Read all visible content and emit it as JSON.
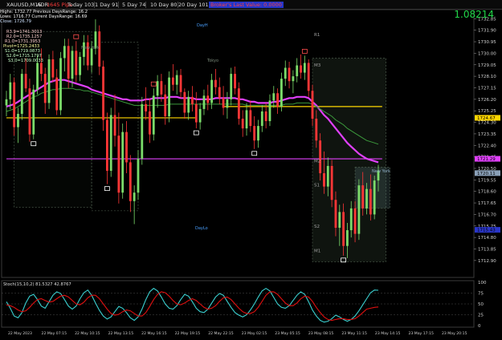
{
  "toolbar": {
    "symbol": "XAUUSD,M15",
    "adr_label": "ADR:",
    "adr_value": "1645 Pips",
    "stats": [
      {
        "label": "Today",
        "value": "103"
      },
      {
        "label": "1 Day",
        "value": "91"
      },
      {
        "label": "5 Day",
        "value": "74"
      },
      {
        "label": "10 Day",
        "value": "80"
      },
      {
        "label": "20 Day",
        "value": "101"
      }
    ],
    "spread_text": "Broker's Last Value: 0.0000"
  },
  "big_price": "1.08214",
  "info_panel": {
    "line1": "Highs: 1732.77 Previous DaysRange: 16.2",
    "line2": "Lows: 1716.77 Current DaysRange: 16.69",
    "line3": "Close: 1726.79",
    "pivots": [
      "R3.9=1741.3013",
      "R2.0=1735.1257",
      "R1.0=1731.3953",
      "Pivot=1725.2433",
      "S1.0=1719.0873",
      "S2.0=1715.1797",
      "S3.0=1709.0033"
    ]
  },
  "chart_data": {
    "type": "candlestick",
    "symbol": "XAUUSD",
    "timeframe": "M15",
    "price_axis": {
      "ylim": [
        1711.5,
        1733.6
      ],
      "ticks": [
        1732.85,
        1731.9,
        1730.95,
        1730.0,
        1729.05,
        1728.1,
        1727.15,
        1726.2,
        1725.25,
        1724.3,
        1723.35,
        1722.4,
        1721.45,
        1720.5,
        1719.55,
        1718.6,
        1717.65,
        1716.7,
        1715.75,
        1714.8,
        1713.85,
        1712.9
      ],
      "markers": [
        {
          "value": 1724.67,
          "color": "#ffd700"
        },
        {
          "value": 1721.29,
          "color": "#e040fb"
        },
        {
          "value": 1720.11,
          "color": "#8aa0b8"
        },
        {
          "value": 1715.43,
          "color": "#2a36c8"
        }
      ]
    },
    "time_axis": [
      "22 May 2023",
      "22 May 07:15",
      "22 May 10:15",
      "22 May 13:15",
      "22 May 16:15",
      "22 May 19:15",
      "22 May 22:15",
      "23 May 02:15",
      "23 May 05:15",
      "23 May 08:15",
      "23 May 11:15",
      "23 May 14:15",
      "23 May 17:15",
      "23 May 20:15"
    ],
    "candles": [
      [
        1725.7,
        1726.9,
        1724.8,
        1726.2
      ],
      [
        1726.2,
        1728.3,
        1725.4,
        1727.6
      ],
      [
        1727.6,
        1728.0,
        1723.2,
        1723.9
      ],
      [
        1723.9,
        1725.5,
        1722.6,
        1725.0
      ],
      [
        1725.0,
        1728.7,
        1724.5,
        1728.3
      ],
      [
        1728.3,
        1729.6,
        1726.8,
        1727.1
      ],
      [
        1727.1,
        1727.9,
        1722.7,
        1723.3
      ],
      [
        1723.3,
        1727.4,
        1722.9,
        1727.0
      ],
      [
        1727.0,
        1729.8,
        1726.6,
        1729.2
      ],
      [
        1729.2,
        1730.4,
        1727.7,
        1728.3
      ],
      [
        1728.3,
        1728.8,
        1725.0,
        1725.9
      ],
      [
        1725.9,
        1729.9,
        1725.4,
        1729.5
      ],
      [
        1729.5,
        1730.2,
        1727.6,
        1728.0
      ],
      [
        1728.0,
        1728.7,
        1724.9,
        1725.3
      ],
      [
        1725.3,
        1730.1,
        1724.9,
        1729.6
      ],
      [
        1729.6,
        1731.2,
        1728.5,
        1730.6
      ],
      [
        1730.6,
        1731.2,
        1727.1,
        1727.9
      ],
      [
        1727.9,
        1730.6,
        1727.2,
        1730.2
      ],
      [
        1730.2,
        1731.0,
        1727.6,
        1728.2
      ],
      [
        1728.2,
        1730.1,
        1727.7,
        1729.7
      ],
      [
        1729.7,
        1731.5,
        1729.0,
        1730.9
      ],
      [
        1730.9,
        1731.5,
        1728.6,
        1729.0
      ],
      [
        1729.0,
        1731.0,
        1728.4,
        1730.4
      ],
      [
        1730.4,
        1732.8,
        1729.9,
        1731.8
      ],
      [
        1731.8,
        1732.3,
        1728.2,
        1728.9
      ],
      [
        1728.9,
        1729.4,
        1723.6,
        1724.5
      ],
      [
        1724.5,
        1725.1,
        1719.2,
        1720.3
      ],
      [
        1720.3,
        1725.5,
        1719.8,
        1724.9
      ],
      [
        1724.9,
        1726.6,
        1722.3,
        1723.2
      ],
      [
        1723.2,
        1725.1,
        1717.6,
        1718.5
      ],
      [
        1718.5,
        1724.2,
        1718.0,
        1723.5
      ],
      [
        1723.5,
        1724.4,
        1720.1,
        1721.0
      ],
      [
        1721.0,
        1721.6,
        1716.9,
        1717.8
      ],
      [
        1717.8,
        1719.1,
        1715.9,
        1718.5
      ],
      [
        1718.5,
        1722.0,
        1717.9,
        1721.3
      ],
      [
        1721.3,
        1726.4,
        1720.8,
        1725.8
      ],
      [
        1725.8,
        1727.2,
        1724.5,
        1725.2
      ],
      [
        1725.2,
        1726.3,
        1722.6,
        1723.3
      ],
      [
        1723.3,
        1727.1,
        1722.8,
        1726.5
      ],
      [
        1726.5,
        1728.2,
        1725.5,
        1727.7
      ],
      [
        1727.7,
        1728.3,
        1726.0,
        1726.6
      ],
      [
        1726.6,
        1727.4,
        1724.1,
        1724.8
      ],
      [
        1724.8,
        1728.5,
        1724.3,
        1728.0
      ],
      [
        1728.0,
        1729.1,
        1726.9,
        1727.4
      ],
      [
        1727.4,
        1728.6,
        1726.6,
        1728.2
      ],
      [
        1728.2,
        1728.7,
        1726.3,
        1726.8
      ],
      [
        1726.8,
        1727.1,
        1724.6,
        1725.1
      ],
      [
        1725.1,
        1726.9,
        1724.5,
        1726.4
      ],
      [
        1726.4,
        1727.3,
        1725.2,
        1725.8
      ],
      [
        1725.8,
        1726.8,
        1723.8,
        1724.3
      ],
      [
        1724.3,
        1725.9,
        1723.7,
        1725.4
      ],
      [
        1725.4,
        1727.0,
        1724.9,
        1726.5
      ],
      [
        1726.5,
        1727.4,
        1725.3,
        1725.9
      ],
      [
        1725.9,
        1728.3,
        1725.4,
        1727.8
      ],
      [
        1727.8,
        1728.7,
        1726.6,
        1727.2
      ],
      [
        1727.2,
        1728.0,
        1725.8,
        1726.3
      ],
      [
        1726.3,
        1727.3,
        1724.9,
        1725.5
      ],
      [
        1725.5,
        1726.8,
        1724.6,
        1726.2
      ],
      [
        1726.2,
        1728.8,
        1725.7,
        1728.3
      ],
      [
        1728.3,
        1728.9,
        1726.6,
        1727.1
      ],
      [
        1727.1,
        1727.6,
        1724.1,
        1724.6
      ],
      [
        1724.6,
        1725.3,
        1723.1,
        1723.8
      ],
      [
        1723.8,
        1725.9,
        1723.2,
        1725.3
      ],
      [
        1725.3,
        1726.1,
        1723.5,
        1724.0
      ],
      [
        1724.0,
        1724.8,
        1722.1,
        1722.8
      ],
      [
        1722.8,
        1724.5,
        1722.2,
        1724.0
      ],
      [
        1724.0,
        1725.7,
        1723.5,
        1725.2
      ],
      [
        1725.2,
        1725.9,
        1723.8,
        1724.4
      ],
      [
        1724.4,
        1726.6,
        1724.0,
        1726.1
      ],
      [
        1726.1,
        1727.3,
        1725.5,
        1726.7
      ],
      [
        1726.7,
        1727.1,
        1725.0,
        1725.6
      ],
      [
        1725.6,
        1728.4,
        1725.2,
        1727.9
      ],
      [
        1727.9,
        1729.4,
        1727.3,
        1728.8
      ],
      [
        1728.8,
        1729.3,
        1727.1,
        1727.7
      ],
      [
        1727.7,
        1728.6,
        1726.7,
        1728.1
      ],
      [
        1728.1,
        1729.6,
        1727.6,
        1729.0
      ],
      [
        1729.0,
        1729.9,
        1727.9,
        1728.4
      ],
      [
        1728.4,
        1729.8,
        1727.8,
        1729.2
      ],
      [
        1729.2,
        1729.5,
        1726.4,
        1726.9
      ],
      [
        1726.9,
        1727.4,
        1724.0,
        1724.6
      ],
      [
        1724.6,
        1725.3,
        1722.2,
        1722.8
      ],
      [
        1722.8,
        1723.4,
        1719.5,
        1720.1
      ],
      [
        1720.1,
        1721.9,
        1718.4,
        1719.0
      ],
      [
        1719.0,
        1721.4,
        1718.2,
        1720.7
      ],
      [
        1720.7,
        1721.2,
        1717.3,
        1717.9
      ],
      [
        1717.9,
        1718.6,
        1714.9,
        1715.6
      ],
      [
        1715.6,
        1717.5,
        1714.1,
        1716.9
      ],
      [
        1716.9,
        1717.6,
        1713.3,
        1714.1
      ],
      [
        1714.1,
        1716.0,
        1713.1,
        1715.4
      ],
      [
        1715.4,
        1717.8,
        1714.8,
        1717.2
      ],
      [
        1717.2,
        1717.8,
        1714.4,
        1715.1
      ],
      [
        1715.1,
        1719.6,
        1714.6,
        1719.1
      ],
      [
        1719.1,
        1720.2,
        1716.6,
        1717.2
      ],
      [
        1717.2,
        1719.3,
        1716.7,
        1718.8
      ],
      [
        1718.8,
        1720.0,
        1716.2,
        1716.7
      ],
      [
        1716.7,
        1719.9,
        1716.3,
        1719.5
      ],
      [
        1719.5,
        1720.8,
        1718.6,
        1720.3
      ]
    ],
    "moving_averages": [
      {
        "color": "#e040fb",
        "values": [
          1725.6,
          1725.7,
          1725.8,
          1726.0,
          1726.2,
          1726.4,
          1726.6,
          1726.8,
          1727.0,
          1727.2,
          1727.4,
          1727.6,
          1727.7,
          1727.8,
          1727.8,
          1727.8,
          1727.7,
          1727.6,
          1727.5,
          1727.4,
          1727.3,
          1727.2,
          1727.0,
          1726.9,
          1726.8,
          1726.7,
          1726.6,
          1726.5,
          1726.4,
          1726.3,
          1726.2,
          1726.2,
          1726.1,
          1726.1,
          1726.1,
          1726.1,
          1726.2,
          1726.2,
          1726.3,
          1726.3,
          1726.3,
          1726.3,
          1726.4,
          1726.4,
          1726.4,
          1726.3,
          1726.3,
          1726.3,
          1726.3,
          1726.2,
          1726.2,
          1726.2,
          1726.2,
          1726.2,
          1726.3,
          1726.3,
          1726.3,
          1726.3,
          1726.3,
          1726.3,
          1726.2,
          1726.2,
          1726.1,
          1726.0,
          1726.0,
          1725.9,
          1725.9,
          1725.9,
          1725.9,
          1726.0,
          1726.0,
          1726.1,
          1726.2,
          1726.3,
          1726.3,
          1726.4,
          1726.4,
          1726.4,
          1726.3,
          1726.0,
          1725.7,
          1725.3,
          1724.9,
          1724.6,
          1724.2,
          1723.8,
          1723.4,
          1723.0,
          1722.6,
          1722.3,
          1722.0,
          1721.7,
          1721.5,
          1721.3,
          1721.2,
          1721.1,
          1721.0
        ]
      },
      {
        "color": "#3c9a3c",
        "values": [
          1725.2,
          1725.3,
          1725.4,
          1725.6,
          1725.8,
          1726.0,
          1726.2,
          1726.4,
          1726.5,
          1726.7,
          1726.8,
          1726.9,
          1727.0,
          1727.0,
          1727.1,
          1727.1,
          1727.1,
          1727.1,
          1727.0,
          1727.0,
          1726.9,
          1726.9,
          1726.8,
          1726.7,
          1726.6,
          1726.5,
          1726.4,
          1726.3,
          1726.2,
          1726.1,
          1726.0,
          1725.9,
          1725.8,
          1725.7,
          1725.7,
          1725.7,
          1725.7,
          1725.7,
          1725.7,
          1725.7,
          1725.7,
          1725.7,
          1725.8,
          1725.8,
          1725.8,
          1725.8,
          1725.8,
          1725.8,
          1725.8,
          1725.8,
          1725.8,
          1725.8,
          1725.8,
          1725.8,
          1725.8,
          1725.8,
          1725.8,
          1725.8,
          1725.8,
          1725.8,
          1725.8,
          1725.8,
          1725.7,
          1725.7,
          1725.7,
          1725.7,
          1725.7,
          1725.7,
          1725.7,
          1725.7,
          1725.7,
          1725.7,
          1725.8,
          1725.8,
          1725.8,
          1725.9,
          1725.9,
          1725.9,
          1725.9,
          1725.8,
          1725.6,
          1725.4,
          1725.2,
          1725.0,
          1724.8,
          1724.5,
          1724.3,
          1724.1,
          1723.8,
          1723.6,
          1723.4,
          1723.2,
          1723.0,
          1722.8,
          1722.7,
          1722.6,
          1722.5
        ]
      }
    ],
    "horizontal_levels": [
      {
        "value": 1724.67,
        "color": "#ffd700",
        "from": 0,
        "to": 49
      },
      {
        "value": 1725.6,
        "color": "#ffd700",
        "from": 56,
        "to": 97
      },
      {
        "value": 1721.29,
        "color": "#e040fb",
        "from": 0,
        "to": 97
      }
    ],
    "zone_labels": [
      "R1",
      "M3",
      "M2",
      "S1",
      "S2",
      "M1"
    ],
    "text_labels": [
      "DayH",
      "DayLo",
      "New York",
      "New York",
      "Tokyo"
    ],
    "swing_markers": [
      {
        "i": 18,
        "kind": "high"
      },
      {
        "i": 38,
        "kind": "high"
      },
      {
        "i": 77,
        "kind": "high"
      },
      {
        "i": 7,
        "kind": "low"
      },
      {
        "i": 26,
        "kind": "low"
      },
      {
        "i": 49,
        "kind": "low"
      },
      {
        "i": 64,
        "kind": "low"
      },
      {
        "i": 87,
        "kind": "low"
      }
    ],
    "oscillator": {
      "title": "Stoch(15,10,2) 81.5327 42.8767",
      "ylim": [
        0,
        100
      ],
      "ticks": [
        100,
        75,
        50,
        25,
        0
      ],
      "levels": [
        75,
        50,
        25
      ],
      "series": [
        {
          "color": "#3ad0d0",
          "values": [
            55,
            40,
            22,
            18,
            30,
            52,
            68,
            72,
            60,
            45,
            40,
            55,
            70,
            78,
            74,
            60,
            45,
            38,
            45,
            62,
            76,
            82,
            70,
            52,
            35,
            22,
            15,
            20,
            32,
            44,
            40,
            30,
            18,
            12,
            20,
            38,
            60,
            78,
            86,
            80,
            66,
            50,
            40,
            38,
            46,
            60,
            72,
            68,
            55,
            40,
            32,
            30,
            38,
            52,
            66,
            74,
            70,
            56,
            42,
            30,
            24,
            20,
            25,
            36,
            50,
            66,
            80,
            86,
            80,
            65,
            50,
            42,
            40,
            46,
            58,
            70,
            78,
            72,
            55,
            36,
            22,
            12,
            8,
            10,
            16,
            24,
            20,
            14,
            10,
            14,
            22,
            34,
            48,
            62,
            76,
            82,
            81.5
          ]
        },
        {
          "color": "#e01010",
          "values": [
            48,
            46,
            42,
            36,
            32,
            34,
            42,
            52,
            60,
            62,
            58,
            54,
            56,
            62,
            68,
            70,
            66,
            58,
            50,
            48,
            54,
            64,
            70,
            70,
            62,
            50,
            38,
            28,
            24,
            26,
            32,
            36,
            34,
            28,
            22,
            22,
            30,
            44,
            60,
            72,
            78,
            76,
            68,
            58,
            50,
            48,
            52,
            58,
            62,
            58,
            50,
            42,
            38,
            40,
            46,
            56,
            64,
            66,
            60,
            50,
            40,
            32,
            28,
            28,
            32,
            42,
            56,
            70,
            78,
            78,
            72,
            62,
            52,
            46,
            46,
            52,
            62,
            68,
            66,
            56,
            42,
            30,
            20,
            14,
            12,
            14,
            16,
            16,
            14,
            14,
            16,
            22,
            30,
            38,
            40,
            42,
            42.9
          ]
        }
      ]
    }
  }
}
